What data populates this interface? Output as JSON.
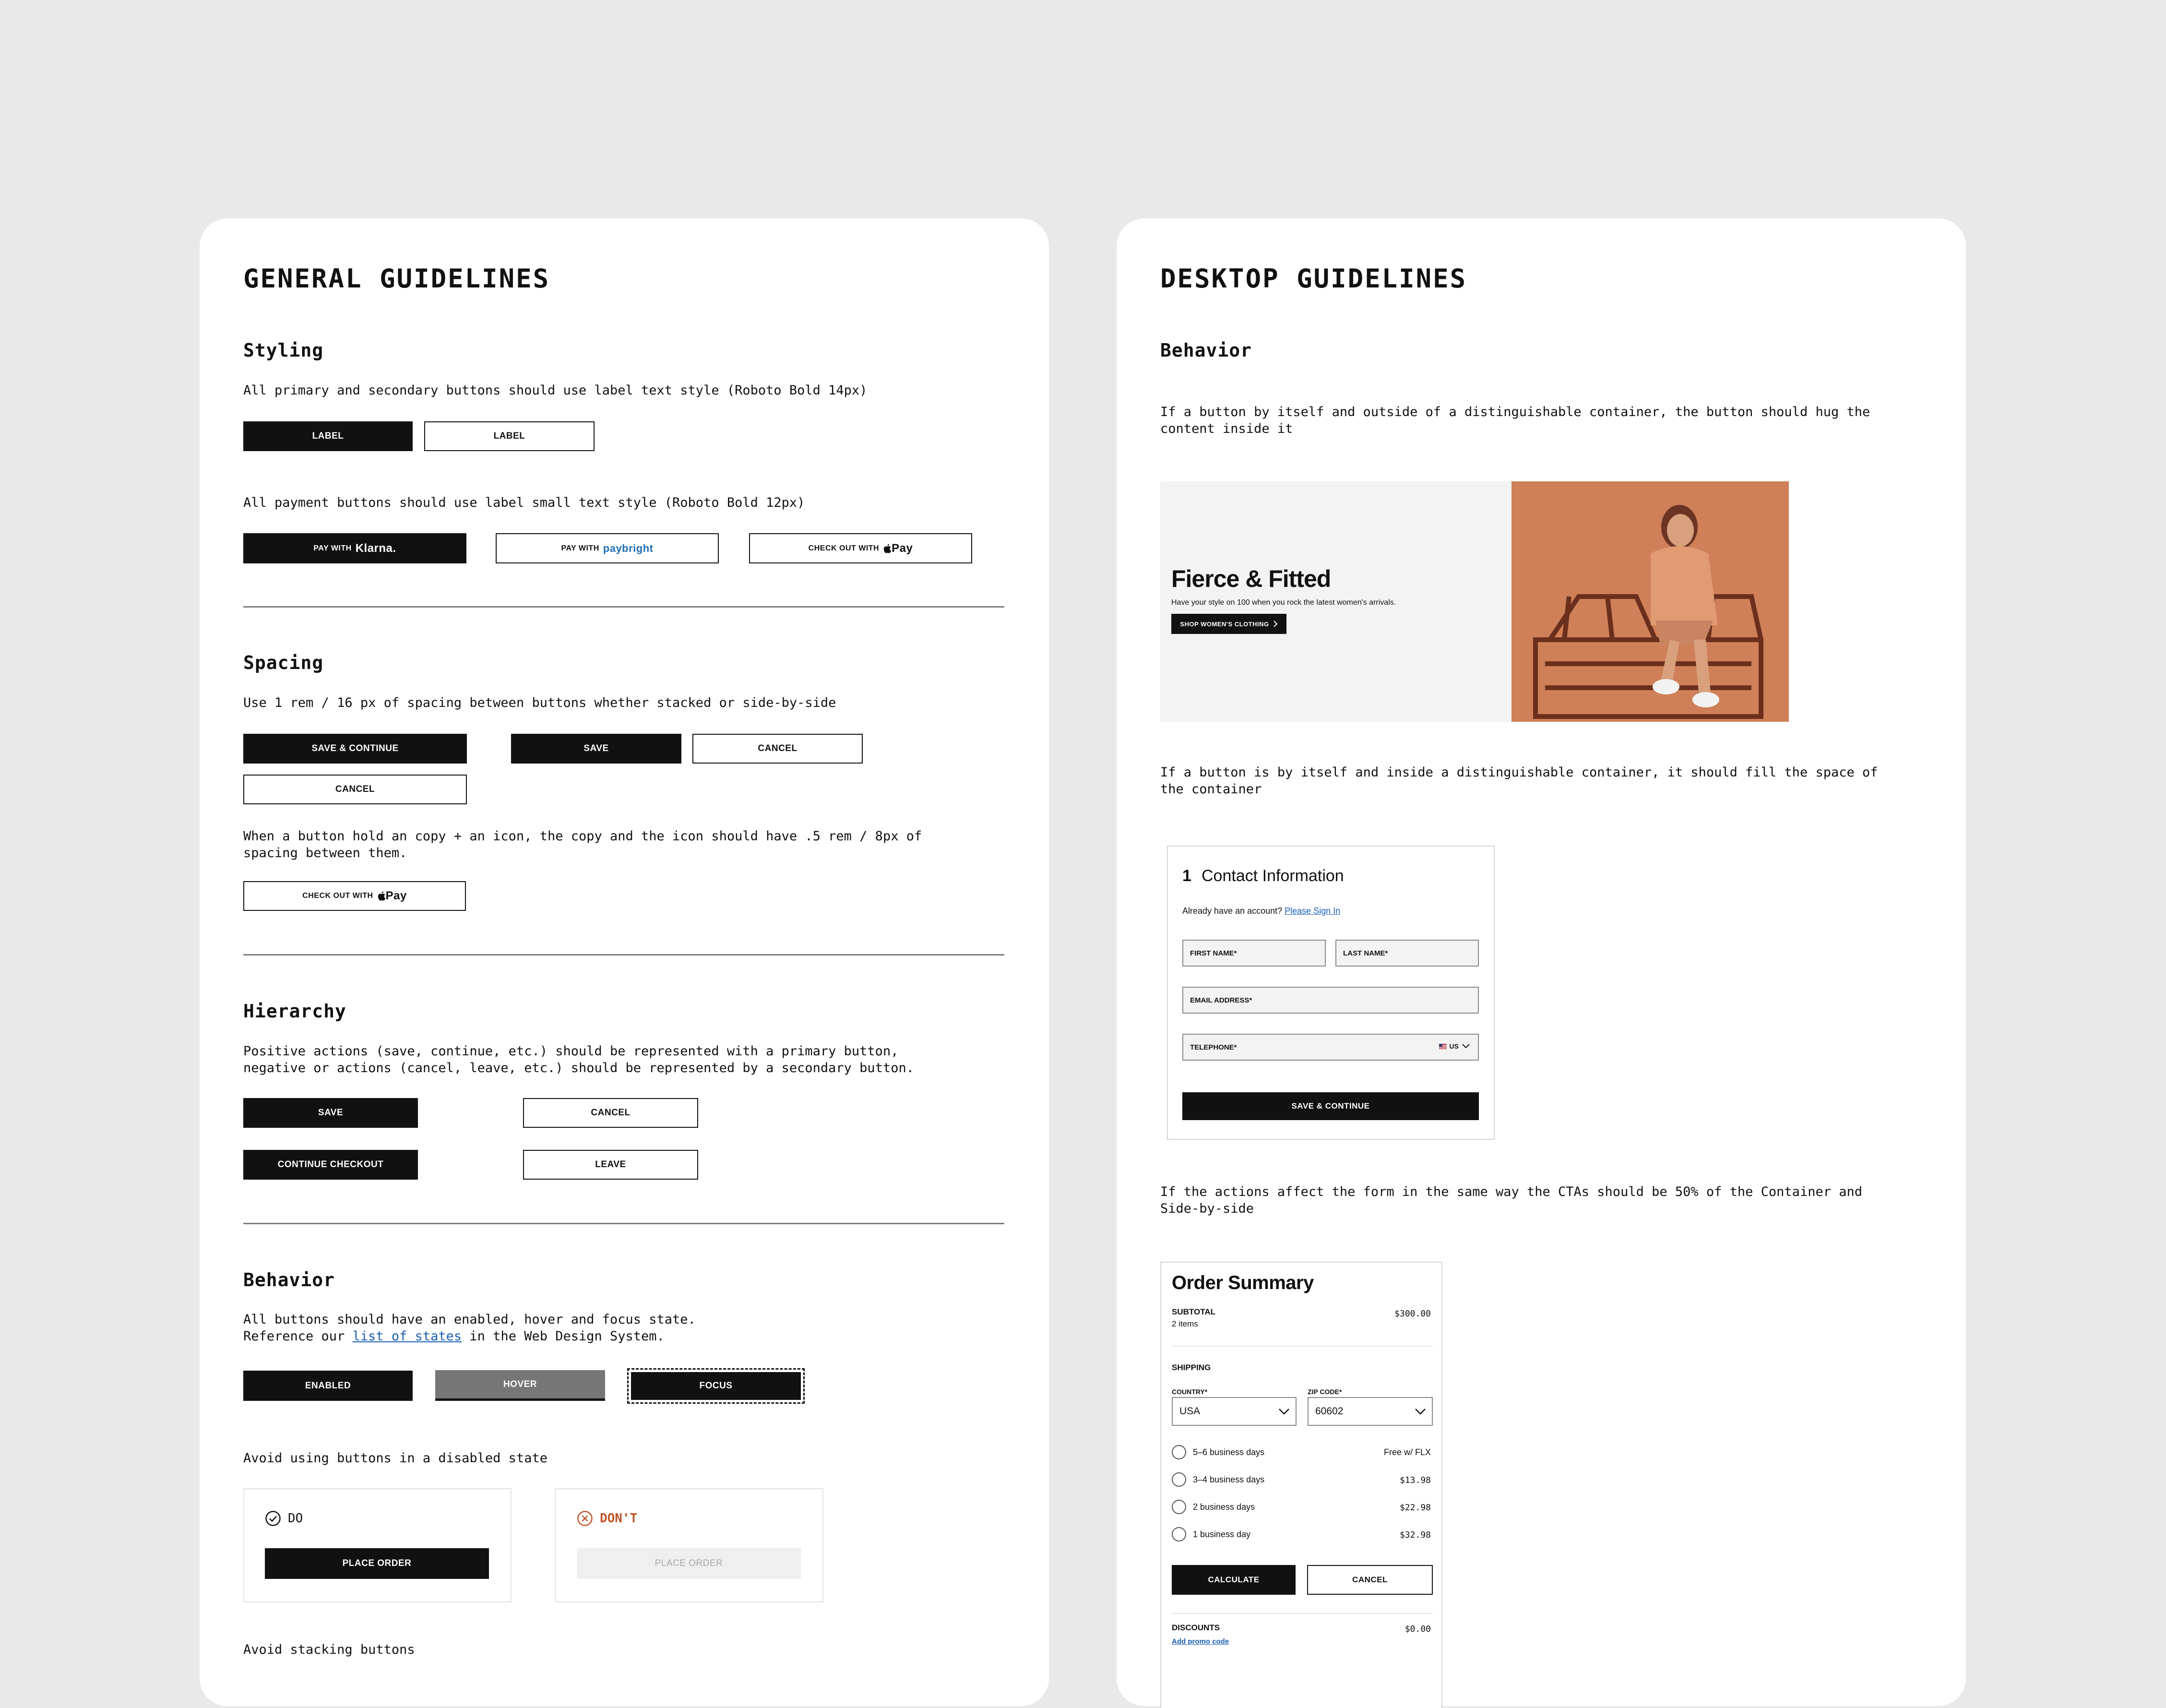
{
  "general": {
    "title": "GENERAL GUIDELINES",
    "styling": {
      "heading": "Styling",
      "text1": "All primary and secondary buttons should use label text style (Roboto Bold 14px)",
      "btn_primary": "LABEL",
      "btn_secondary": "LABEL",
      "text2": "All payment buttons should use label small text style (Roboto Bold 12px)",
      "pay_with": "PAY WITH",
      "klarna": "Klarna.",
      "paybright": "paybright",
      "check_out_with": "CHECK OUT WITH",
      "apple_pay": "Pay"
    },
    "spacing": {
      "heading": "Spacing",
      "text1": "Use 1 rem / 16 px  of spacing between buttons whether stacked or side-by-side",
      "save_continue": "SAVE & CONTINUE",
      "cancel_stacked": "CANCEL",
      "save": "SAVE",
      "cancel_side": "CANCEL",
      "text2": "When a button hold an copy + an icon, the copy and the icon should have .5 rem / 8px of\nspacing between them.",
      "check_out_with": "CHECK OUT WITH",
      "apple_pay": "Pay"
    },
    "hierarchy": {
      "heading": "Hierarchy",
      "text": "Positive actions (save, continue, etc.) should be represented with a primary button,\nnegative or  actions (cancel, leave, etc.) should be represented by a secondary button.",
      "save": "SAVE",
      "cancel": "CANCEL",
      "continue_checkout": "CONTINUE CHECKOUT",
      "leave": "LEAVE"
    },
    "behavior": {
      "heading": "Behavior",
      "text_pre": "All buttons should have an enabled, hover and focus state.\nReference our ",
      "link": "list of states",
      "text_post": " in the Web Design System.",
      "enabled": "ENABLED",
      "hover": "HOVER",
      "focus": "FOCUS",
      "text_disabled": "Avoid using buttons in a disabled state",
      "do_label": "DO",
      "dont_label": "DON'T",
      "place_order_do": "PLACE ORDER",
      "place_order_dont": "PLACE ORDER",
      "cut_text": "Avoid stacking buttons"
    }
  },
  "desktop": {
    "title": "DESKTOP GUIDELINES",
    "behavior_heading": "Behavior",
    "text1": "If a button by itself and outside of a distinguishable container, the button should hug the\ncontent inside it",
    "banner": {
      "title": "Fierce & Fitted",
      "subtitle": "Have your style on 100 when you rock the latest women's arrivals.",
      "cta": "SHOP WOMEN'S CLOTHING"
    },
    "text2": "If a button is by itself and inside a distinguishable container, it should fill the space of\nthe container",
    "contact": {
      "step": "1",
      "title": "Contact Information",
      "account_text": "Already have an account? ",
      "sign_in": "Please Sign In",
      "first_name": "FIRST NAME*",
      "last_name": "LAST NAME*",
      "email": "EMAIL ADDRESS*",
      "telephone": "TELEPHONE*",
      "country_code": "US",
      "cta": "SAVE & CONTINUE"
    },
    "text3": "If the actions affect the form in the same way the CTAs should be 50% of the Container and\nSide-by-side",
    "order": {
      "title": "Order Summary",
      "subtotal_label": "SUBTOTAL",
      "subtotal_items": "2 items",
      "subtotal_value": "$300.00",
      "shipping_label": "SHIPPING",
      "country_label": "COUNTRY*",
      "country_value": "USA",
      "zip_label": "ZIP CODE*",
      "zip_value": "60602",
      "options": [
        {
          "label": "5–6 business days",
          "price": "Free w/ FLX"
        },
        {
          "label": "3–4 business days",
          "price": "$13.98"
        },
        {
          "label": "2 business days",
          "price": "$22.98"
        },
        {
          "label": "1 business day",
          "price": "$32.98"
        }
      ],
      "calculate": "CALCULATE",
      "cancel": "CANCEL",
      "discounts_label": "DISCOUNTS",
      "discounts_value": "$0.00",
      "promo_link": "Add promo code"
    }
  },
  "colors": {
    "background": "#e9e9e9",
    "card": "#ffffff",
    "primary": "#111111",
    "hover": "#767676",
    "link": "#1a5fb4",
    "dont": "#c0552a",
    "banner_photo": "#c8764f"
  }
}
